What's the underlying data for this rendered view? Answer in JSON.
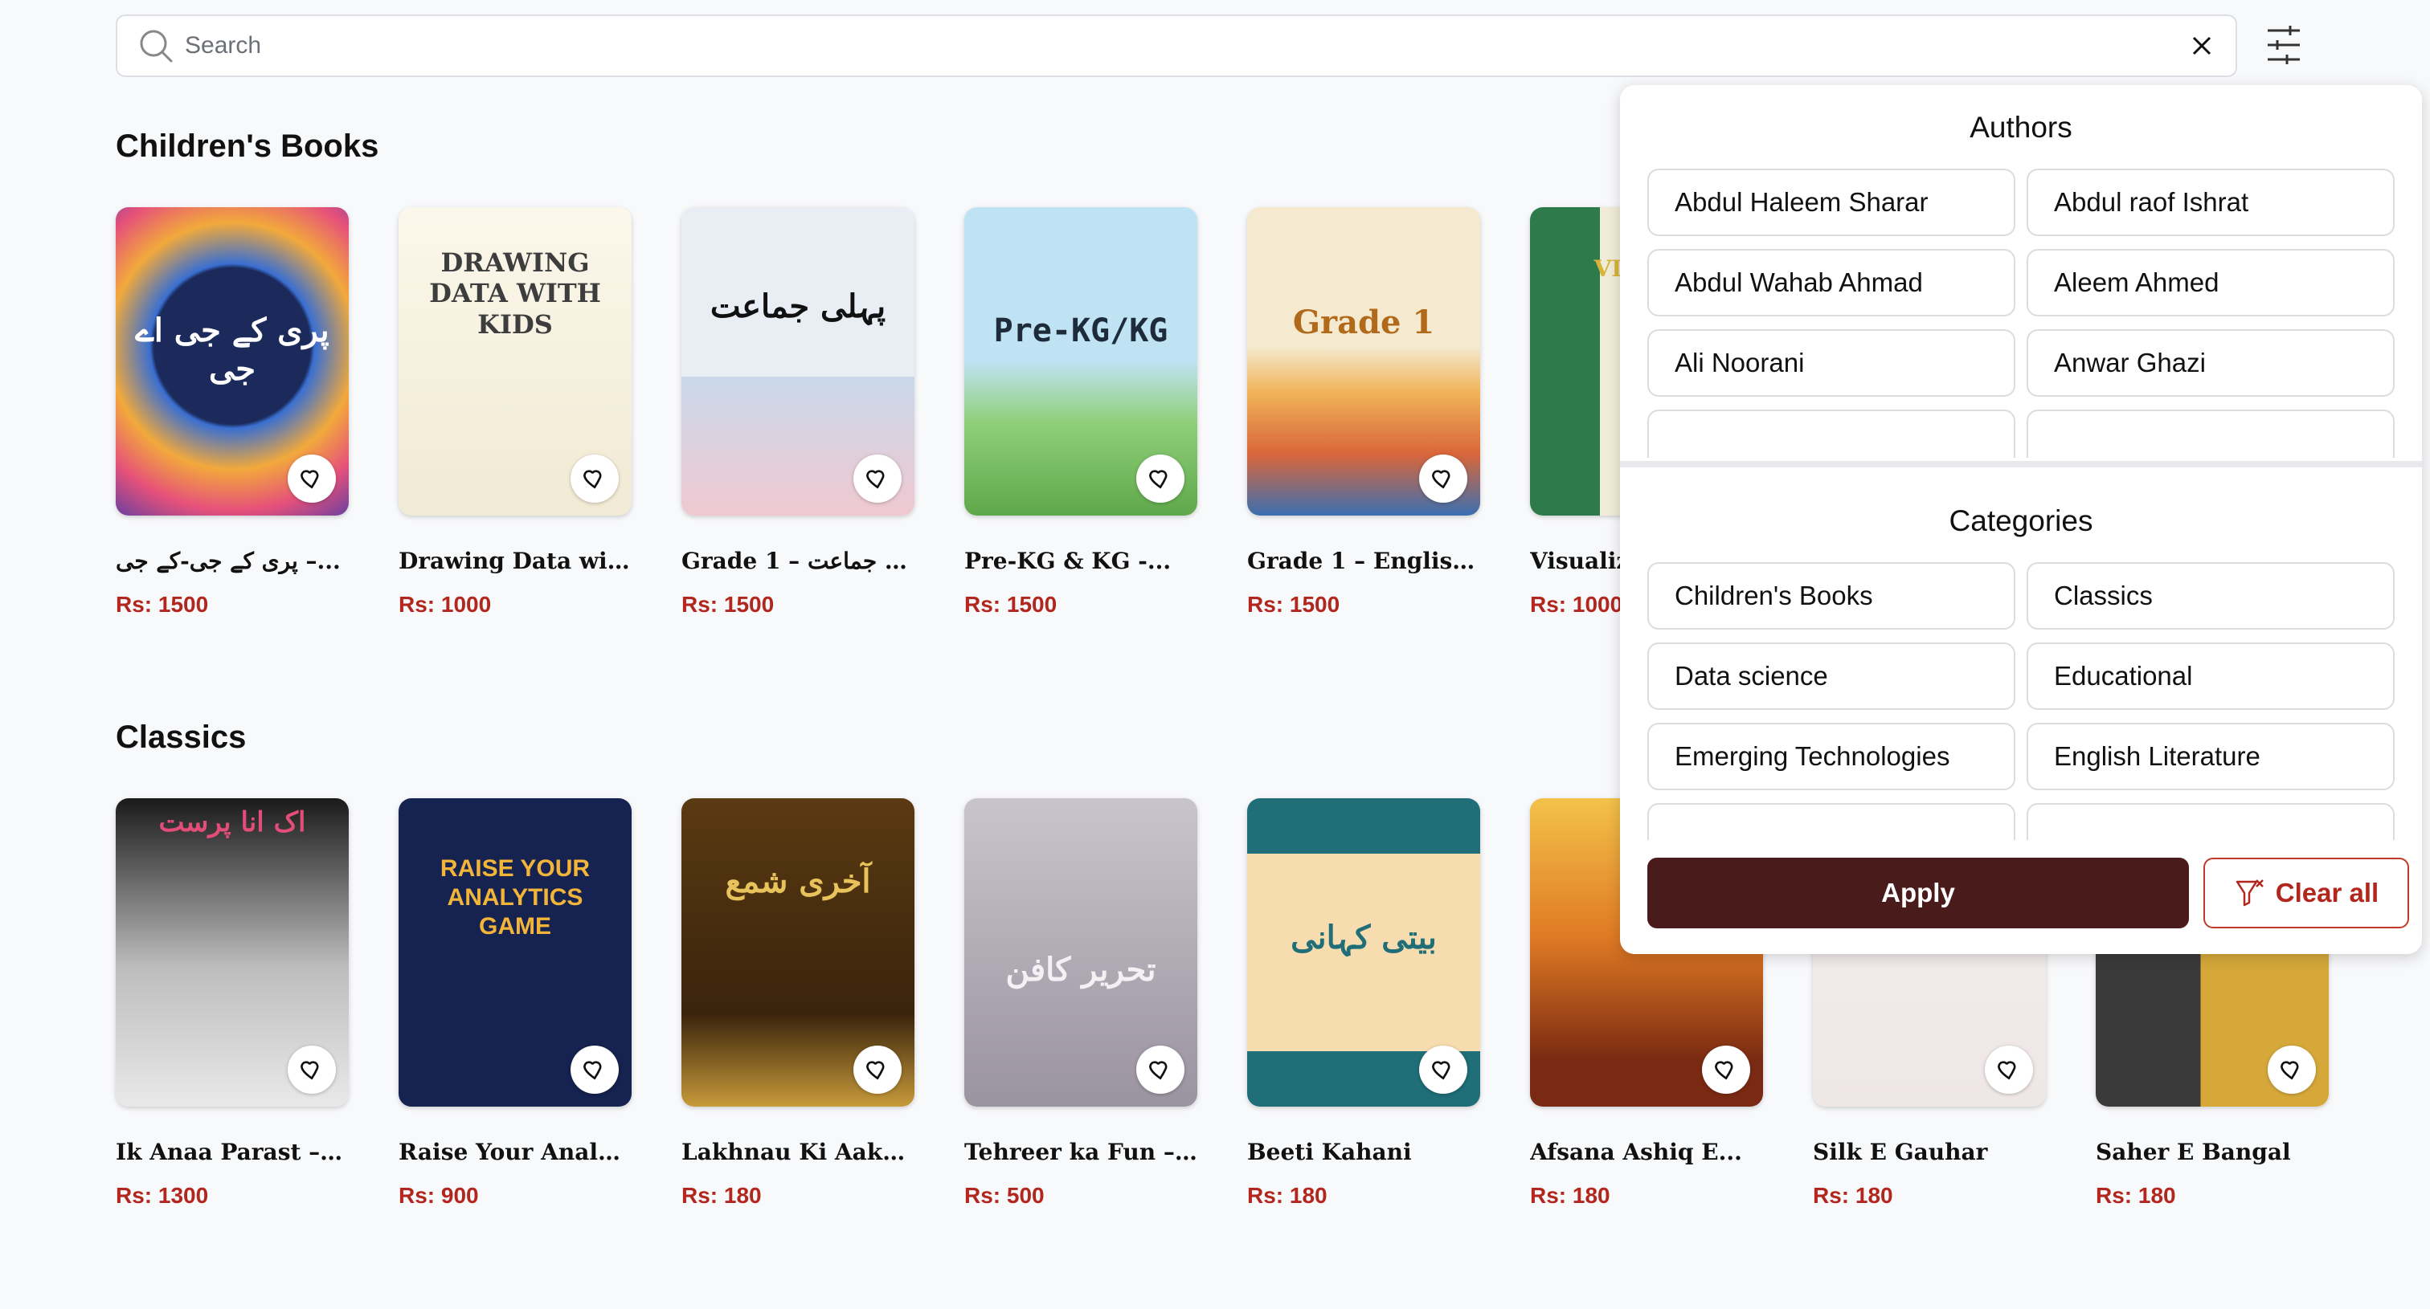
{
  "search": {
    "placeholder": "Search"
  },
  "icons": {
    "search": "search-icon",
    "clear": "close-icon",
    "filter": "sliders-icon",
    "favorite": "heart-icon",
    "clear_filter": "filter-clear-icon"
  },
  "colors": {
    "price": "#b3261e",
    "apply_bg": "#4a1b1b",
    "clear_border": "#c0392b"
  },
  "sections": [
    {
      "title": "Children's Books",
      "books": [
        {
          "title": "پری کے جی-کے جی –...",
          "price": "Rs: 1500",
          "cover_text": "پری کے جی اے جی"
        },
        {
          "title": "Drawing Data with...",
          "price": "Rs: 1000",
          "cover_text": "DRAWING DATA WITH KIDS"
        },
        {
          "title": "Grade 1 – پہلی جماعت",
          "price": "Rs: 1500",
          "cover_text": "پہلی جماعت"
        },
        {
          "title": "Pre-KG & KG -...",
          "price": "Rs: 1500",
          "cover_text": "Pre-KG/KG"
        },
        {
          "title": "Grade 1 – English...",
          "price": "Rs: 1500",
          "cover_text": "Grade 1"
        },
        {
          "title": "Visualiz",
          "price": "Rs: 1000",
          "cover_text": "VIS PRA"
        }
      ]
    },
    {
      "title": "Classics",
      "books": [
        {
          "title": "Ik Anaa Parast – اک...",
          "price": "Rs: 1300",
          "cover_text": "اک انا پرست"
        },
        {
          "title": "Raise Your Analyti...",
          "price": "Rs: 900",
          "cover_text": "RAISE YOUR ANALYTICS GAME"
        },
        {
          "title": "Lakhnau Ki Aakhri...",
          "price": "Rs: 180",
          "cover_text": "آخری شمع"
        },
        {
          "title": "Tehreer ka Fun –...",
          "price": "Rs: 500",
          "cover_text": "تحریر کافن"
        },
        {
          "title": "Beeti Kahani",
          "price": "Rs: 180",
          "cover_text": "بیتی کہانی"
        },
        {
          "title": "Afsana Ashiq E...",
          "price": "Rs: 180",
          "cover_text": ""
        },
        {
          "title": "Silk E Gauhar",
          "price": "Rs: 180",
          "cover_text": ""
        },
        {
          "title": "Saher E Bangal",
          "price": "Rs: 180",
          "cover_text": ""
        }
      ]
    }
  ],
  "filter_panel": {
    "authors_title": "Authors",
    "authors": [
      "Abdul Haleem Sharar",
      "Abdul raof Ishrat",
      "Abdul Wahab Ahmad",
      "Aleem Ahmed",
      "Ali Noorani",
      "Anwar Ghazi",
      "",
      ""
    ],
    "categories_title": "Categories",
    "categories": [
      "Children's Books",
      "Classics",
      "Data science",
      "Educational",
      "Emerging Technologies",
      "English Literature",
      "",
      ""
    ],
    "apply_label": "Apply",
    "clear_label": "Clear all"
  }
}
